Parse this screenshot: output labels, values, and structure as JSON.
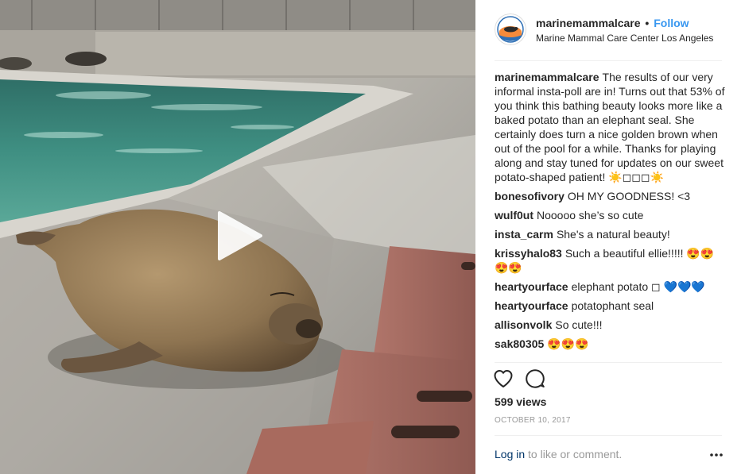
{
  "header": {
    "username": "marinemammalcare",
    "separator": "•",
    "follow_label": "Follow",
    "location": "Marine Mammal Care Center Los Angeles"
  },
  "caption": {
    "username": "marinemammalcare",
    "text": "The results of our very informal insta-poll are in! Turns out that 53% of you think this bathing beauty looks more like a baked potato than an elephant seal. She certainly does turn a nice golden brown when out of the pool for a while. Thanks for playing along and stay tuned for updates on our sweet potato-shaped patient! ☀️◻◻◻☀️"
  },
  "comments": [
    {
      "username": "bonesofivory",
      "text": "OH MY GOODNESS! <3"
    },
    {
      "username": "wulf0ut",
      "text": "Nooooo she’s so cute"
    },
    {
      "username": "insta_carm",
      "text": "She's a natural beauty!"
    },
    {
      "username": "krissyhalo83",
      "text": "Such a beautiful ellie!!!!! 😍😍😍😍"
    },
    {
      "username": "heartyourface",
      "text": "elephant potato ◻ 💙💙💙"
    },
    {
      "username": "heartyourface",
      "text": "potatophant seal"
    },
    {
      "username": "allisonvolk",
      "text": "So cute!!!"
    },
    {
      "username": "sak80305",
      "text": "😍😍😍"
    }
  ],
  "stats": {
    "views": "599 views",
    "date": "OCTOBER 10, 2017"
  },
  "footer": {
    "login_label": "Log in",
    "login_suffix": " to like or comment."
  },
  "icons": {
    "play": "play-icon",
    "like": "heart-outline-icon",
    "comment": "speech-bubble-icon",
    "more": "more-options-icon"
  },
  "colors": {
    "follow": "#3897f0",
    "link": "#003569",
    "muted": "#999999",
    "divider": "#efefef",
    "pool_water": "#3f8c7f"
  }
}
